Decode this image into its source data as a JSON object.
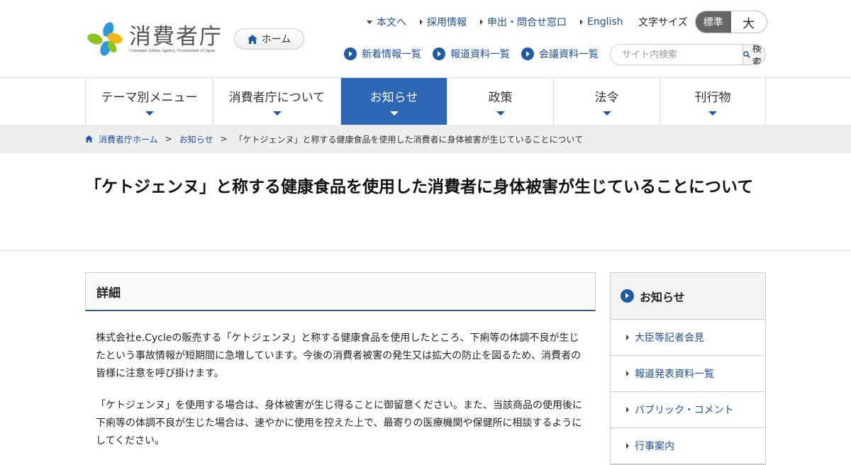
{
  "header": {
    "logo_name": "消費者庁",
    "logo_sub": "Consumer Affairs Agency, Government of Japan",
    "home_label": "ホーム"
  },
  "util_links": [
    {
      "label": "本文へ"
    },
    {
      "label": "採用情報"
    },
    {
      "label": "申出・問合せ窓口"
    },
    {
      "label": "English"
    }
  ],
  "font_size": {
    "label": "文字サイズ",
    "standard": "標準",
    "large": "大",
    "selected": "標準"
  },
  "sub_links": [
    {
      "label": "新着情報一覧"
    },
    {
      "label": "報道資料一覧"
    },
    {
      "label": "会議資料一覧"
    }
  ],
  "search": {
    "placeholder": "サイト内検索",
    "button_label": "検索"
  },
  "gnav": [
    {
      "label": "テーマ別メニュー"
    },
    {
      "label": "消費者庁について"
    },
    {
      "label": "お知らせ"
    },
    {
      "label": "政策"
    },
    {
      "label": "法令"
    },
    {
      "label": "刊行物"
    }
  ],
  "breadcrumb": {
    "home": "消費者庁ホーム",
    "section": "お知らせ",
    "current": "「ケトジェンヌ」と称する健康食品を使用した消費者に身体被害が生じていることについて"
  },
  "page": {
    "title": "「ケトジェンヌ」と称する健康食品を使用した消費者に身体被害が生じていることについて",
    "detail_heading": "詳細",
    "paragraphs": [
      "株式会社e.Cycleの販売する「ケトジェンヌ」と称する健康食品を使用したところ、下痢等の体調不良が生じたという事故情報が短期間に急増しています。今後の消費者被害の発生又は拡大の防止を図るため、消費者の皆様に注意を呼び掛けます。",
      "「ケトジェンヌ」を使用する場合は、身体被害が生じ得ることに御留意ください。また、当該商品の使用後に下痢等の体調不良が生じた場合は、速やかに使用を控えた上で、最寄りの医療機関や保健所に相談するようにしてください。"
    ]
  },
  "sidebar": {
    "heading": "お知らせ",
    "items": [
      {
        "label": "大臣等記者会見"
      },
      {
        "label": "報道発表資料一覧"
      },
      {
        "label": "パブリック・コメント"
      },
      {
        "label": "行事案内"
      }
    ]
  },
  "colors": {
    "accent": "#2d66b5",
    "link": "#1e4fa0"
  }
}
